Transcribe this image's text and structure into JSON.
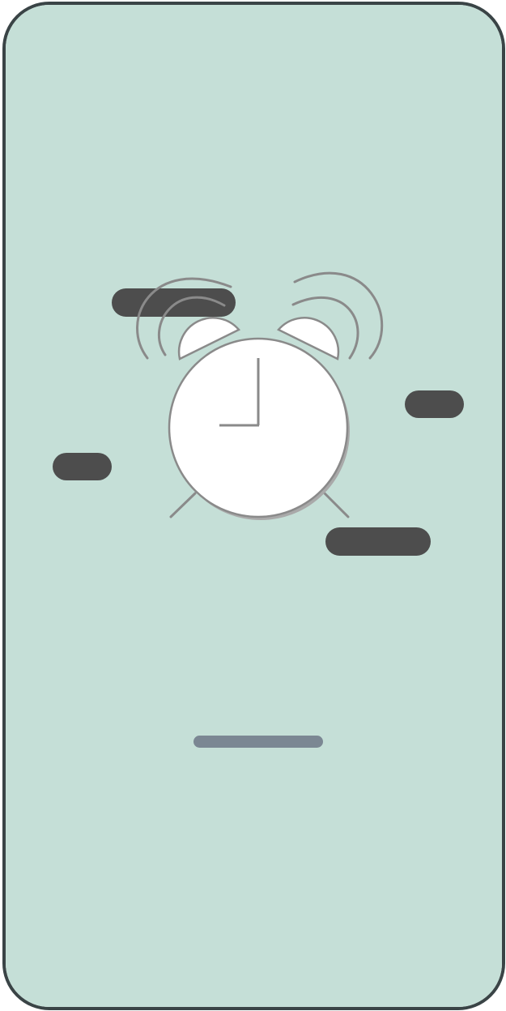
{
  "screen": {
    "background_color": "#c5dfd7",
    "frame_color": "#3a4446"
  },
  "illustration": {
    "icon": "alarm-clock-icon",
    "clock_face_color": "#ffffff",
    "outline_color": "#8a8a8a"
  },
  "floating_pills": {
    "color": "#4d4d4d",
    "count": 4
  },
  "progress_indicator": {
    "color": "#7b8793"
  }
}
